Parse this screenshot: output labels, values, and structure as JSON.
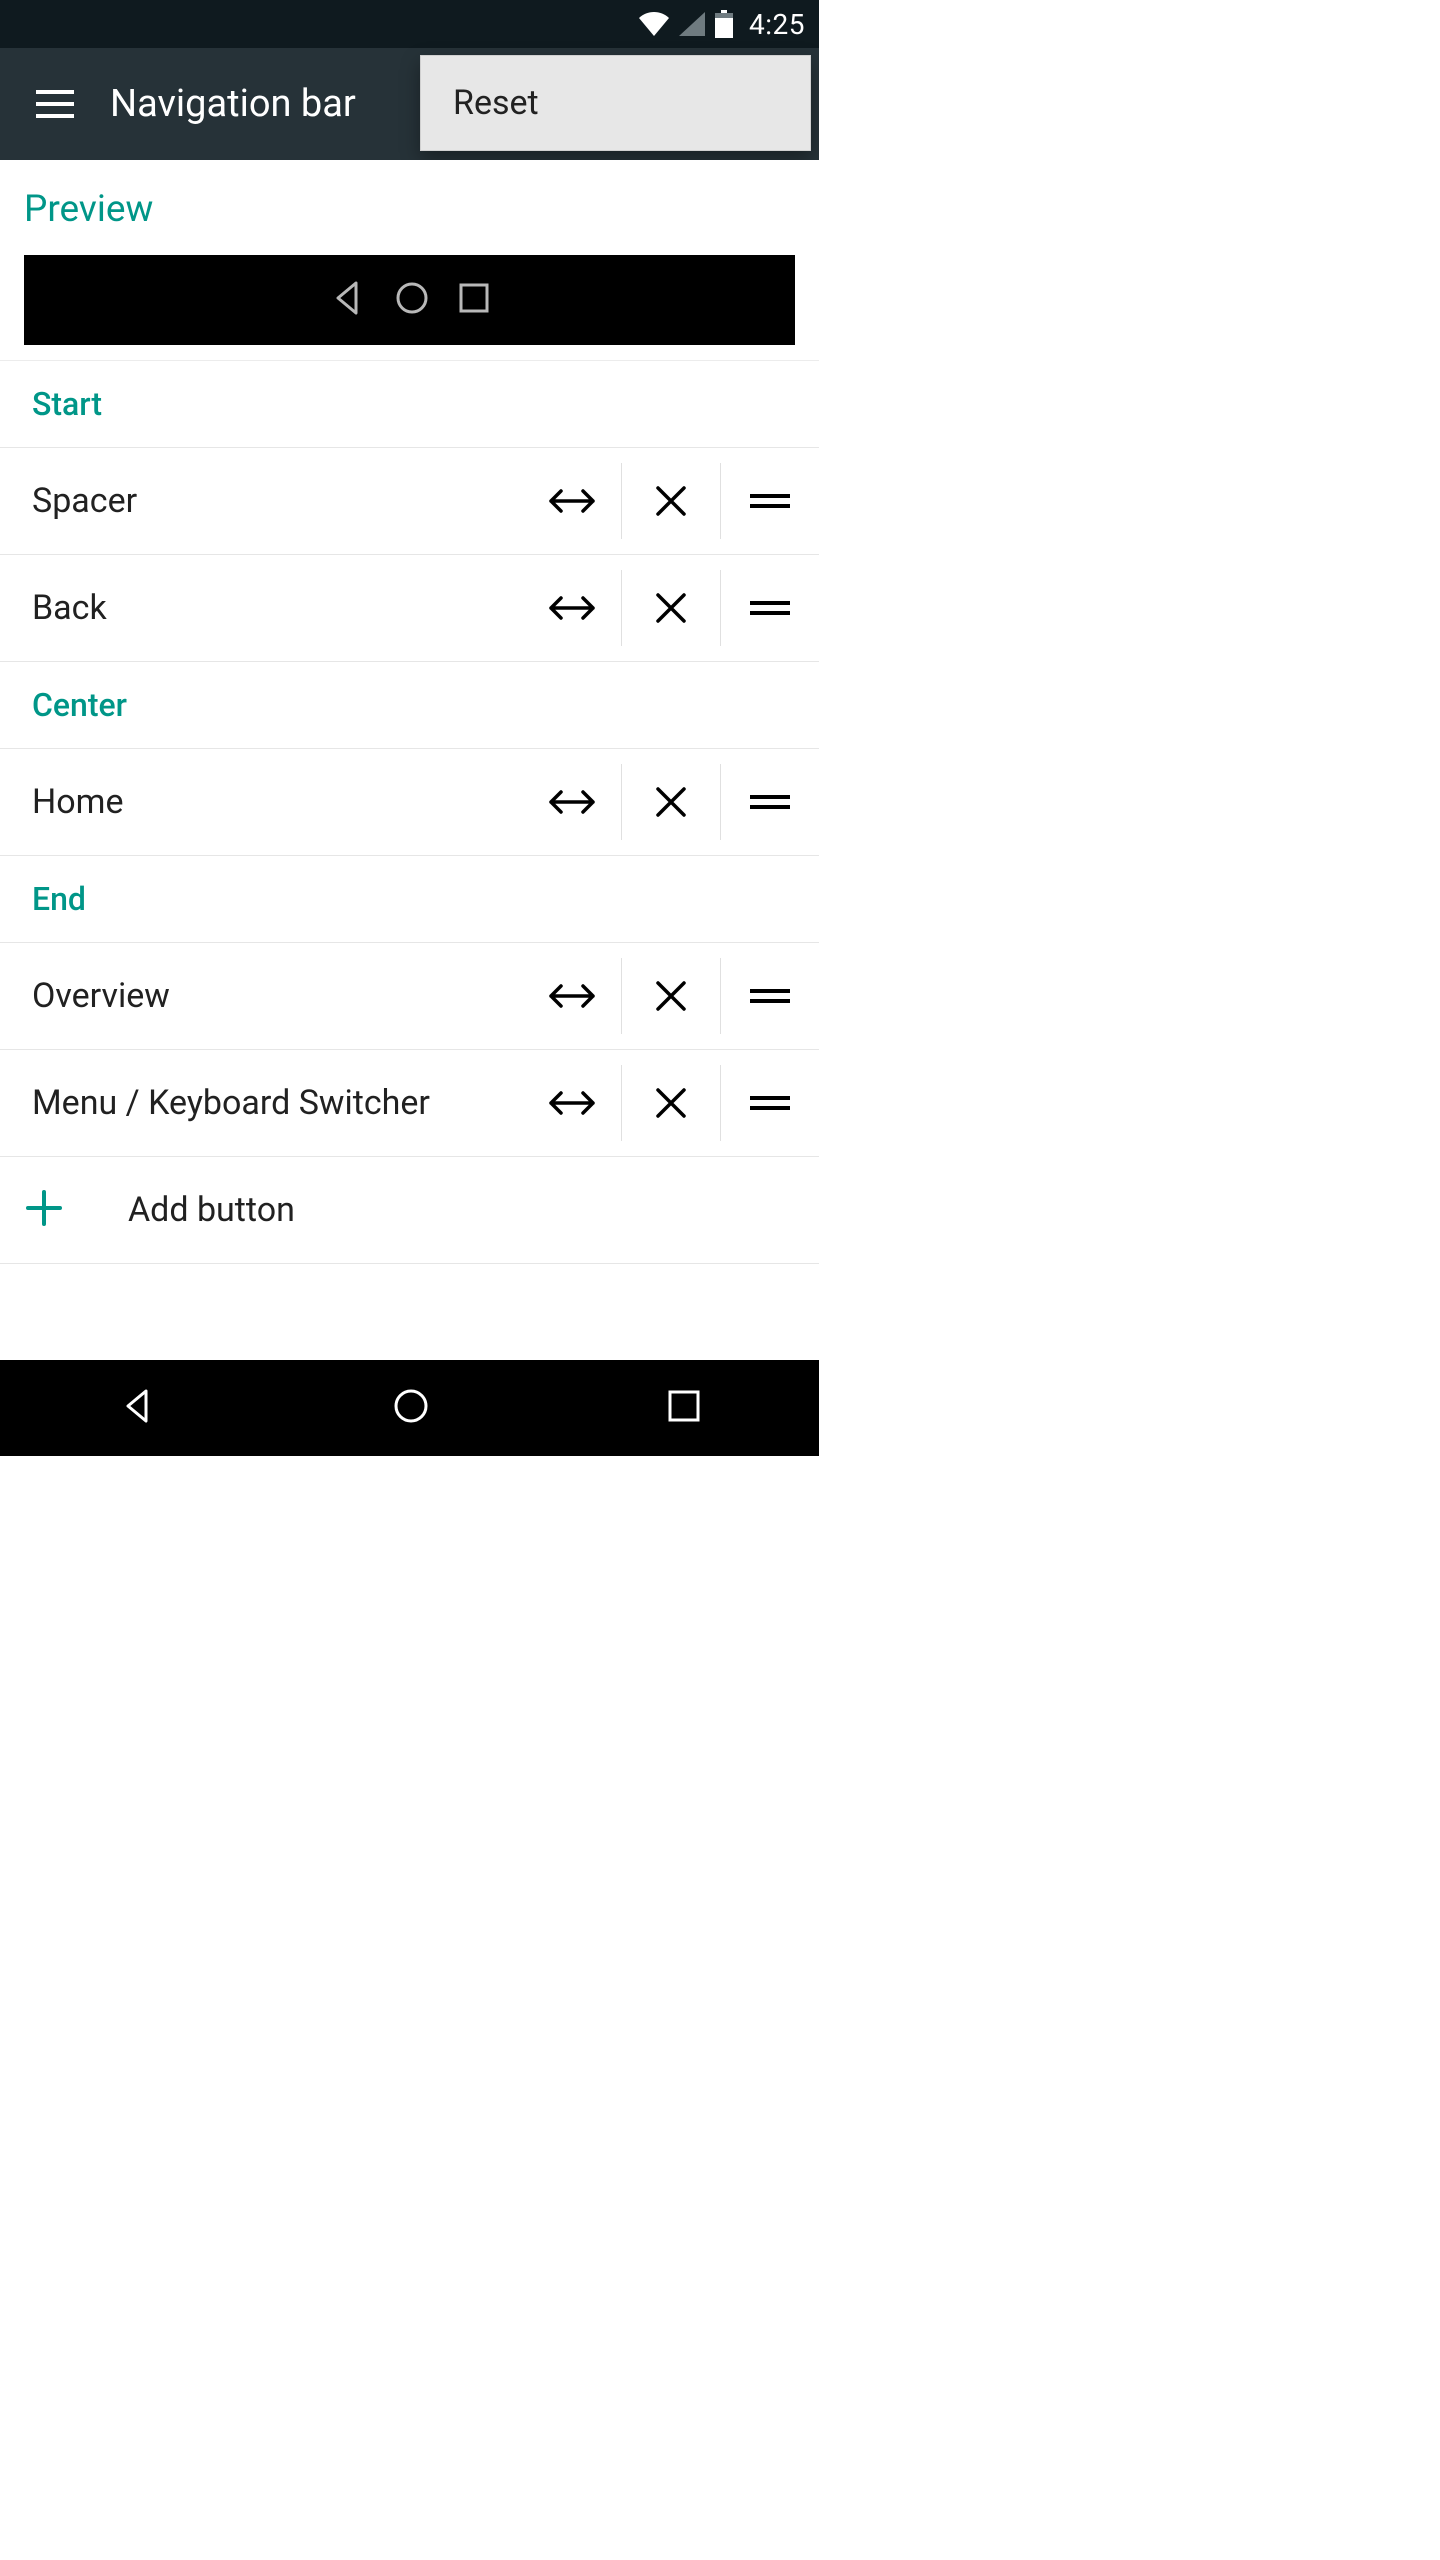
{
  "status_bar": {
    "time": "4:25"
  },
  "app_bar": {
    "title": "Navigation bar"
  },
  "menu": {
    "reset": "Reset"
  },
  "preview": {
    "label": "Preview"
  },
  "sections": {
    "start": {
      "title": "Start",
      "items": [
        {
          "label": "Spacer"
        },
        {
          "label": "Back"
        }
      ]
    },
    "center": {
      "title": "Center",
      "items": [
        {
          "label": "Home"
        }
      ]
    },
    "end": {
      "title": "End",
      "items": [
        {
          "label": "Overview"
        },
        {
          "label": "Menu / Keyboard Switcher"
        }
      ]
    }
  },
  "add_button": {
    "label": "Add button"
  },
  "icons": {
    "hamburger": "hamburger-icon",
    "wifi": "wifi-icon",
    "cell": "cell-signal-icon",
    "battery": "battery-icon",
    "back": "back-icon",
    "home": "home-icon",
    "overview": "overview-icon",
    "width": "width-arrows-icon",
    "delete": "delete-x-icon",
    "drag": "drag-handle-icon",
    "plus": "plus-icon"
  },
  "colors": {
    "accent": "#009688",
    "app_bar_bg": "#263238",
    "status_bg": "#0f1a1f"
  }
}
